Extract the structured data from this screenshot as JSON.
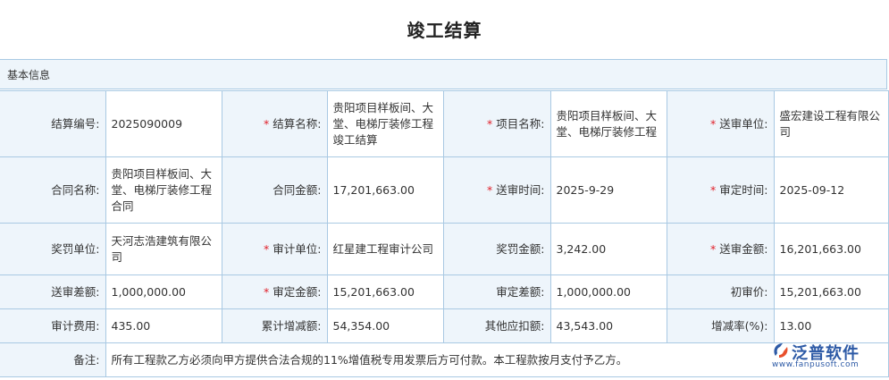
{
  "page": {
    "title": "竣工结算"
  },
  "section": {
    "title": "基本信息"
  },
  "fields": {
    "settle_no": {
      "label": "结算编号:",
      "value": "2025090009",
      "required": false
    },
    "settle_name": {
      "label": "结算名称:",
      "value": "贵阳项目样板间、大堂、电梯厅装修工程竣工结算",
      "required": true
    },
    "project_name": {
      "label": "项目名称:",
      "value": "贵阳项目样板间、大堂、电梯厅装修工程",
      "required": true
    },
    "submit_unit": {
      "label": "送审单位:",
      "value": "盛宏建设工程有限公司",
      "required": true
    },
    "contract_name": {
      "label": "合同名称:",
      "value": "贵阳项目样板间、大堂、电梯厅装修工程合同",
      "required": false
    },
    "contract_amount": {
      "label": "合同金额:",
      "value": "17,201,663.00",
      "required": false
    },
    "submit_time": {
      "label": "送审时间:",
      "value": "2025-9-29",
      "required": true
    },
    "approve_time": {
      "label": "审定时间:",
      "value": "2025-09-12",
      "required": true
    },
    "reward_unit": {
      "label": "奖罚单位:",
      "value": "天河志浩建筑有限公司",
      "required": false
    },
    "audit_unit": {
      "label": "审计单位:",
      "value": "红星建工程审计公司",
      "required": true
    },
    "reward_amount": {
      "label": "奖罚金额:",
      "value": "3,242.00",
      "required": false
    },
    "submit_amount": {
      "label": "送审金额:",
      "value": "16,201,663.00",
      "required": true
    },
    "submit_diff": {
      "label": "送审差额:",
      "value": "1,000,000.00",
      "required": false
    },
    "approve_amount": {
      "label": "审定金额:",
      "value": "15,201,663.00",
      "required": true
    },
    "approve_diff": {
      "label": "审定差额:",
      "value": "1,000,000.00",
      "required": false
    },
    "initial_price": {
      "label": "初审价:",
      "value": "15,201,663.00",
      "required": false
    },
    "audit_fee": {
      "label": "审计费用:",
      "value": "435.00",
      "required": false
    },
    "cum_change": {
      "label": "累计增减额:",
      "value": "54,354.00",
      "required": false
    },
    "other_deduct": {
      "label": "其他应扣额:",
      "value": "43,543.00",
      "required": false
    },
    "change_rate": {
      "label": "增减率(%):",
      "value": "13.00",
      "required": false
    },
    "remark": {
      "label": "备注:",
      "value": "所有工程款乙方必须向甲方提供合法合规的11%增值税专用发票后方可付款。本工程款按月支付予乙方。",
      "required": false
    }
  },
  "required_mark": "*",
  "watermark": {
    "text": "泛普软件",
    "url": "www.fanpusoft.com",
    "color": "#2d5aa6"
  }
}
